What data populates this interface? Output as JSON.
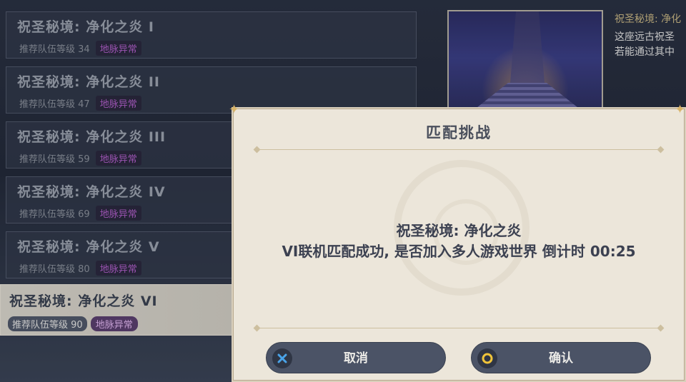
{
  "domains": [
    {
      "name": "祝圣秘境: 净化之炎 I",
      "level": "推荐队伍等级 34",
      "tag": "地脉异常"
    },
    {
      "name": "祝圣秘境: 净化之炎 II",
      "level": "推荐队伍等级 47",
      "tag": "地脉异常"
    },
    {
      "name": "祝圣秘境: 净化之炎 III",
      "level": "推荐队伍等级 59",
      "tag": "地脉异常"
    },
    {
      "name": "祝圣秘境: 净化之炎 IV",
      "level": "推荐队伍等级 69",
      "tag": "地脉异常"
    },
    {
      "name": "祝圣秘境: 净化之炎 V",
      "level": "推荐队伍等级 80",
      "tag": "地脉异常"
    },
    {
      "name": "祝圣秘境: 净化之炎 VI",
      "level": "推荐队伍等级 90",
      "tag": "地脉异常"
    }
  ],
  "info": {
    "title": "祝圣秘境: 净化",
    "desc_line1": "这座远古祝圣",
    "desc_line2": "若能通过其中"
  },
  "dialog": {
    "title": "匹配挑战",
    "message_line1": "祝圣秘境: 净化之炎",
    "message_line2": "VI联机匹配成功, 是否加入多人游戏世界 倒计时 00:25",
    "cancel_label": "取消",
    "confirm_label": "确认"
  },
  "icons": {
    "cancel": "x-button-icon",
    "confirm": "circle-button-icon"
  },
  "colors": {
    "cancel_icon": "#4aa3e8",
    "confirm_icon": "#f0c43a",
    "tag": "#b15fcb"
  }
}
